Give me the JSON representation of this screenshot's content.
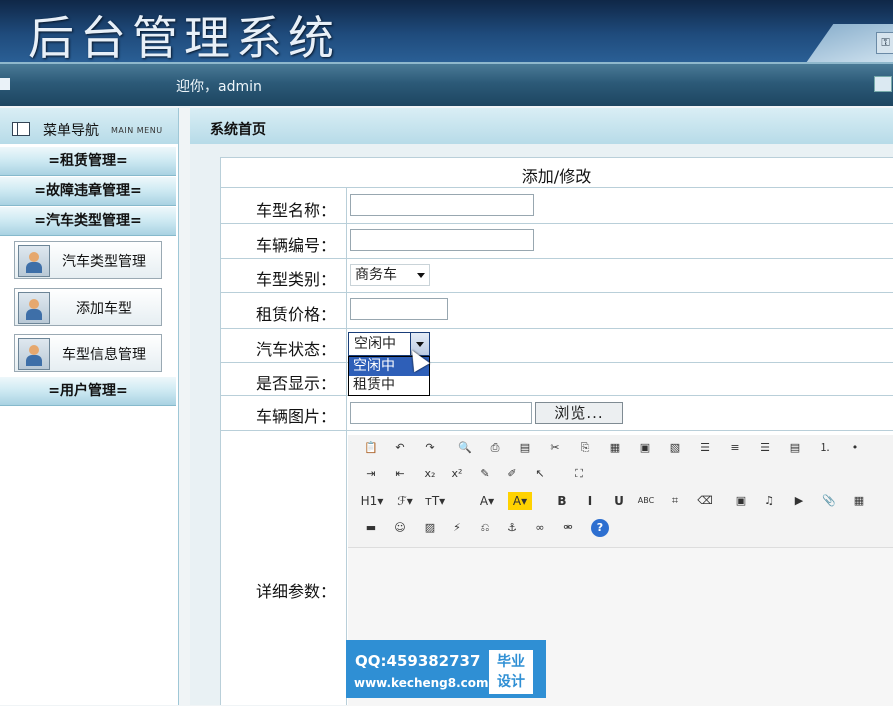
{
  "header": {
    "title": "后台管理系统",
    "welcome": "迎你，admin"
  },
  "sidebar": {
    "title": "菜单导航",
    "subtitle": "MAIN MENU",
    "categories": [
      "=租赁管理=",
      "=故障违章管理=",
      "=汽车类型管理=",
      "=用户管理="
    ],
    "items": [
      "汽车类型管理",
      "添加车型",
      "车型信息管理"
    ]
  },
  "main": {
    "breadcrumb": "系统首页",
    "form": {
      "title": "添加/修改",
      "fields": {
        "name": {
          "label": "车型名称："
        },
        "number": {
          "label": "车辆编号："
        },
        "type": {
          "label": "车型类别：",
          "value": "商务车"
        },
        "price": {
          "label": "租赁价格："
        },
        "status": {
          "label": "汽车状态：",
          "value": "空闲中",
          "options": [
            "空闲中",
            "租赁中"
          ]
        },
        "show": {
          "label": "是否显示："
        },
        "image": {
          "label": "车辆图片：",
          "browse": "浏览..."
        },
        "details": {
          "label": "详细参数："
        }
      }
    },
    "toolbar": {
      "row1": [
        "paste-icon",
        "undo-icon",
        "redo-icon",
        "preview-icon",
        "print-icon",
        "template-icon",
        "cut-icon",
        "copy-icon",
        "paste-plain-icon",
        "paste-text-icon",
        "paste-word-icon",
        "align-left-icon",
        "align-center-icon",
        "align-right-icon",
        "justify-icon",
        "ordered-list-icon",
        "unordered-list-icon"
      ],
      "row2": [
        "indent-icon",
        "outdent-icon",
        "subscript-icon",
        "superscript-icon",
        "clear-format-icon",
        "select-all-icon",
        "pointer-icon",
        "fullscreen-icon"
      ],
      "row3_labels": [
        "H1▾",
        "ℱ▾",
        "тT▾",
        "A▾",
        "A▾",
        "B",
        "I",
        "U",
        "ABC"
      ],
      "row4": [
        "hr-icon",
        "emoticon-icon",
        "image-icon",
        "flash-icon",
        "page-break-icon",
        "anchor-icon",
        "link-icon",
        "unlink-icon",
        "help-icon"
      ]
    }
  },
  "watermark": {
    "qq": "QQ:459382737",
    "url": "www.kecheng8.com",
    "badge": "毕业\n设计"
  }
}
